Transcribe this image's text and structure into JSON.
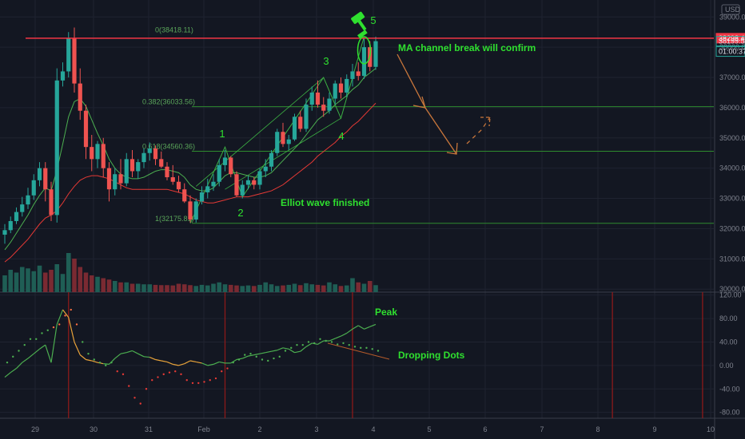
{
  "chart_data": {
    "type": "candlestick",
    "symbol_currency": "USD",
    "x_tick_labels": [
      "29",
      "30",
      "31",
      "Feb",
      "2",
      "3",
      "4",
      "5",
      "6",
      "7",
      "8",
      "9",
      "10"
    ],
    "price_axis": {
      "ticks": [
        30000,
        31000,
        32000,
        33000,
        34000,
        35000,
        36000,
        37000,
        38000,
        39000
      ],
      "tick_labels": [
        "30000.00",
        "31000.00",
        "32000.00",
        "33000.00",
        "34000.00",
        "35000.00",
        "36000.00",
        "37000.00",
        "38000.00",
        "39000.00"
      ],
      "top_label": "39000.00",
      "range": [
        29900,
        39350
      ],
      "grid": true
    },
    "price_tags": [
      {
        "label": "38298.49",
        "value": 38298.49,
        "color": "#f23645"
      },
      {
        "label": "38199.54",
        "value": 38199.54,
        "color": "#26a69a"
      },
      {
        "label": "01:00:37",
        "color": "#26a69a"
      }
    ],
    "resistance_value": 38298.49,
    "fib_levels": [
      {
        "label": "0(38418.11)",
        "value": 38418.11
      },
      {
        "label": "0.382(36033.56)",
        "value": 36033.56
      },
      {
        "label": "0.618(34560.36)",
        "value": 34560.36
      },
      {
        "label": "1(32175.81)",
        "value": 32175.81
      }
    ],
    "candles": [
      {
        "o": 31800,
        "h": 32150,
        "l": 31500,
        "c": 31950
      },
      {
        "o": 31950,
        "h": 32400,
        "l": 31850,
        "c": 32250
      },
      {
        "o": 32250,
        "h": 32700,
        "l": 32150,
        "c": 32550
      },
      {
        "o": 32550,
        "h": 33050,
        "l": 32400,
        "c": 32800
      },
      {
        "o": 32800,
        "h": 33350,
        "l": 32650,
        "c": 33100
      },
      {
        "o": 33100,
        "h": 33800,
        "l": 32950,
        "c": 33600
      },
      {
        "o": 33600,
        "h": 34200,
        "l": 33400,
        "c": 34000
      },
      {
        "o": 34000,
        "h": 34200,
        "l": 32900,
        "c": 33300
      },
      {
        "o": 33300,
        "h": 33550,
        "l": 32250,
        "c": 32450
      },
      {
        "o": 32450,
        "h": 37300,
        "l": 32200,
        "c": 36900
      },
      {
        "o": 36900,
        "h": 37500,
        "l": 36700,
        "c": 37200
      },
      {
        "o": 37200,
        "h": 38500,
        "l": 37000,
        "c": 38300
      },
      {
        "o": 38300,
        "h": 38650,
        "l": 36500,
        "c": 36800
      },
      {
        "o": 36800,
        "h": 37300,
        "l": 35600,
        "c": 35900
      },
      {
        "o": 35900,
        "h": 36100,
        "l": 34300,
        "c": 34700
      },
      {
        "o": 34700,
        "h": 35100,
        "l": 33900,
        "c": 34300
      },
      {
        "o": 34300,
        "h": 34900,
        "l": 34000,
        "c": 34800
      },
      {
        "o": 34800,
        "h": 35000,
        "l": 33700,
        "c": 34000
      },
      {
        "o": 34000,
        "h": 34200,
        "l": 32900,
        "c": 33300
      },
      {
        "o": 33300,
        "h": 34000,
        "l": 33100,
        "c": 33800
      },
      {
        "o": 33800,
        "h": 34300,
        "l": 33300,
        "c": 33500
      },
      {
        "o": 33500,
        "h": 34500,
        "l": 33400,
        "c": 34300
      },
      {
        "o": 34300,
        "h": 34600,
        "l": 33700,
        "c": 33900
      },
      {
        "o": 33900,
        "h": 34300,
        "l": 33650,
        "c": 34200
      },
      {
        "o": 34200,
        "h": 34650,
        "l": 34000,
        "c": 34500
      },
      {
        "o": 34500,
        "h": 34850,
        "l": 34250,
        "c": 34650
      },
      {
        "o": 34650,
        "h": 34750,
        "l": 34100,
        "c": 34300
      },
      {
        "o": 34300,
        "h": 34550,
        "l": 34000,
        "c": 34050
      },
      {
        "o": 34050,
        "h": 34200,
        "l": 33600,
        "c": 33700
      },
      {
        "o": 33700,
        "h": 34100,
        "l": 33450,
        "c": 33550
      },
      {
        "o": 33550,
        "h": 33750,
        "l": 33200,
        "c": 33300
      },
      {
        "o": 33300,
        "h": 33500,
        "l": 32850,
        "c": 32900
      },
      {
        "o": 32900,
        "h": 33100,
        "l": 32200,
        "c": 32300
      },
      {
        "o": 32300,
        "h": 33000,
        "l": 32200,
        "c": 32900
      },
      {
        "o": 32900,
        "h": 33400,
        "l": 32800,
        "c": 33200
      },
      {
        "o": 33200,
        "h": 33650,
        "l": 33000,
        "c": 33400
      },
      {
        "o": 33400,
        "h": 33800,
        "l": 33250,
        "c": 33550
      },
      {
        "o": 33550,
        "h": 34300,
        "l": 33400,
        "c": 34100
      },
      {
        "o": 34100,
        "h": 34600,
        "l": 33900,
        "c": 34350
      },
      {
        "o": 34350,
        "h": 34400,
        "l": 33700,
        "c": 33800
      },
      {
        "o": 33800,
        "h": 33900,
        "l": 33050,
        "c": 33100
      },
      {
        "o": 33100,
        "h": 33600,
        "l": 33000,
        "c": 33450
      },
      {
        "o": 33450,
        "h": 33750,
        "l": 33300,
        "c": 33600
      },
      {
        "o": 33600,
        "h": 33700,
        "l": 33300,
        "c": 33450
      },
      {
        "o": 33450,
        "h": 34000,
        "l": 33300,
        "c": 33900
      },
      {
        "o": 33900,
        "h": 34300,
        "l": 33700,
        "c": 34050
      },
      {
        "o": 34050,
        "h": 34600,
        "l": 33900,
        "c": 34500
      },
      {
        "o": 34500,
        "h": 35300,
        "l": 34400,
        "c": 35200
      },
      {
        "o": 35200,
        "h": 35500,
        "l": 34700,
        "c": 34800
      },
      {
        "o": 34800,
        "h": 35100,
        "l": 34600,
        "c": 34950
      },
      {
        "o": 34950,
        "h": 35800,
        "l": 34900,
        "c": 35700
      },
      {
        "o": 35700,
        "h": 35900,
        "l": 35200,
        "c": 35300
      },
      {
        "o": 35300,
        "h": 36300,
        "l": 35200,
        "c": 36100
      },
      {
        "o": 36100,
        "h": 36700,
        "l": 35900,
        "c": 36500
      },
      {
        "o": 36500,
        "h": 36900,
        "l": 36000,
        "c": 36100
      },
      {
        "o": 36100,
        "h": 36350,
        "l": 35700,
        "c": 35900
      },
      {
        "o": 35900,
        "h": 36500,
        "l": 35800,
        "c": 36300
      },
      {
        "o": 36300,
        "h": 36900,
        "l": 36100,
        "c": 36800
      },
      {
        "o": 36800,
        "h": 37000,
        "l": 36300,
        "c": 36500
      },
      {
        "o": 36500,
        "h": 37100,
        "l": 36350,
        "c": 36950
      },
      {
        "o": 36950,
        "h": 37450,
        "l": 36700,
        "c": 37200
      },
      {
        "o": 37200,
        "h": 37500,
        "l": 36900,
        "c": 37050
      },
      {
        "o": 37050,
        "h": 38300,
        "l": 36950,
        "c": 38000
      },
      {
        "o": 38000,
        "h": 38200,
        "l": 37200,
        "c": 37350
      },
      {
        "o": 37350,
        "h": 38350,
        "l": 37250,
        "c": 38200
      }
    ],
    "ma_fast": [
      31300,
      31550,
      31850,
      32150,
      32450,
      32800,
      33100,
      33350,
      33250,
      33950,
      34800,
      35700,
      36200,
      36300,
      36050,
      35600,
      35150,
      34750,
      34300,
      34000,
      33800,
      33700,
      33650,
      33650,
      33700,
      33800,
      33900,
      33950,
      33950,
      33900,
      33850,
      33700,
      33450,
      33300,
      33250,
      33250,
      33350,
      33550,
      33750,
      33850,
      33850,
      33800,
      33750,
      33700,
      33700,
      33750,
      33850,
      34050,
      34250,
      34450,
      34650,
      34850,
      35100,
      35350,
      35600,
      35750,
      35900,
      36100,
      36250,
      36400,
      36600,
      36750,
      37000,
      37150,
      37300
    ],
    "ma_slow": [
      30900,
      31050,
      31250,
      31450,
      31650,
      31900,
      32150,
      32350,
      32450,
      32600,
      32850,
      33150,
      33400,
      33600,
      33700,
      33750,
      33750,
      33700,
      33650,
      33550,
      33450,
      33350,
      33300,
      33300,
      33300,
      33300,
      33300,
      33300,
      33300,
      33250,
      33200,
      33150,
      33050,
      32950,
      32900,
      32850,
      32850,
      32900,
      32950,
      33000,
      33050,
      33050,
      33050,
      33100,
      33150,
      33200,
      33250,
      33350,
      33450,
      33600,
      33750,
      33900,
      34050,
      34200,
      34400,
      34550,
      34700,
      34850,
      35050,
      35200,
      35400,
      35550,
      35750,
      35950,
      36150
    ],
    "volumes": [
      60,
      80,
      70,
      90,
      85,
      75,
      95,
      70,
      80,
      100,
      65,
      140,
      120,
      90,
      70,
      60,
      55,
      50,
      45,
      40,
      35,
      35,
      30,
      30,
      28,
      28,
      26,
      25,
      25,
      24,
      30,
      28,
      25,
      22,
      26,
      24,
      30,
      35,
      28,
      26,
      24,
      22,
      24,
      22,
      26,
      35,
      28,
      22,
      24,
      26,
      30,
      25,
      32,
      28,
      26,
      24,
      35,
      28,
      22,
      24,
      50,
      35,
      30,
      40,
      25
    ],
    "sub_panel": {
      "axis_ticks": [
        -80,
        -40,
        0,
        40,
        80,
        120
      ],
      "axis_labels": [
        "-80.00",
        "-40.00",
        "0.00",
        "40.00",
        "80.00",
        "120.00"
      ],
      "range": [
        -90,
        125
      ],
      "momentum_line": [
        -20,
        -12,
        -5,
        5,
        12,
        20,
        28,
        35,
        5,
        70,
        95,
        82,
        40,
        18,
        10,
        8,
        5,
        3,
        2,
        12,
        20,
        22,
        25,
        20,
        15,
        14,
        10,
        8,
        6,
        2,
        0,
        3,
        8,
        6,
        4,
        0,
        2,
        6,
        4,
        4,
        10,
        12,
        16,
        18,
        20,
        22,
        24,
        26,
        30,
        28,
        22,
        24,
        32,
        38,
        36,
        42,
        42,
        46,
        50,
        55,
        62,
        68,
        62,
        66,
        70
      ],
      "dots": [
        5,
        15,
        25,
        35,
        45,
        45,
        55,
        60,
        65,
        70,
        85,
        95,
        70,
        40,
        20,
        10,
        5,
        0,
        5,
        -10,
        -15,
        -35,
        -55,
        -65,
        -40,
        -25,
        -20,
        -15,
        -12,
        -10,
        -15,
        -25,
        -30,
        -30,
        -28,
        -25,
        -22,
        -10,
        -5,
        5,
        10,
        18,
        20,
        15,
        10,
        8,
        12,
        15,
        25,
        30,
        35,
        35,
        40,
        38,
        45,
        42,
        40,
        36,
        38,
        35,
        32,
        30,
        30,
        28,
        25
      ],
      "vertical_markers_index": [
        11,
        38,
        60
      ],
      "vertical_markers_future_x_label_pos": [
        8.25,
        9.85
      ]
    },
    "annotations": {
      "wave_labels": [
        {
          "text": "1",
          "index": 38,
          "value": 34850
        },
        {
          "text": "2",
          "index": 42,
          "value": 32250
        },
        {
          "text": "3",
          "index": 54,
          "value": 37500
        },
        {
          "text": "4",
          "index": 59,
          "value": 35000
        },
        {
          "text": "5",
          "index": 62,
          "value": 39000
        }
      ],
      "elliott_text": "Elliot wave finished",
      "ma_channel_text": "MA channel break will confirm",
      "peak_text": "Peak",
      "dropping_text": "Dropping Dots"
    }
  }
}
